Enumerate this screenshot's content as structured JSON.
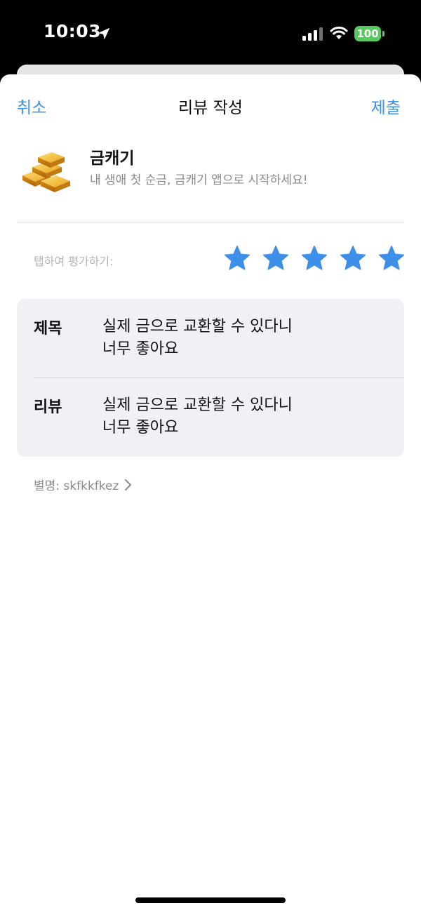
{
  "status_bar": {
    "time": "10:03",
    "battery": "100",
    "icons": [
      "location-arrow-icon",
      "cellular-signal-icon",
      "wifi-icon",
      "battery-icon"
    ]
  },
  "nav": {
    "cancel_label": "취소",
    "title": "리뷰 작성",
    "submit_label": "제출"
  },
  "app": {
    "icon": "gold-bars-icon",
    "name": "금캐기",
    "subtitle": "내 생애 첫 순금, 금캐기 앱으로 시작하세요!"
  },
  "rating": {
    "label": "탭하여 평가하기:",
    "value": 5,
    "max": 5,
    "star_icon": "star-icon"
  },
  "form": {
    "title_label": "제목",
    "title_value": "실제 금으로 교환할 수 있다니\n너무 좋아요",
    "review_label": "리뷰",
    "review_value": "실제 금으로 교환할 수 있다니\n너무 좋아요"
  },
  "nickname": {
    "text": "별명: skfkkfkez",
    "chevron_icon": "chevron-right-icon"
  },
  "colors": {
    "accent": "#3d8fe8",
    "star": "#3d8fe8",
    "battery": "#57c95f",
    "card_background": "#f0f0f5",
    "secondary_text": "#8a8a8e"
  }
}
